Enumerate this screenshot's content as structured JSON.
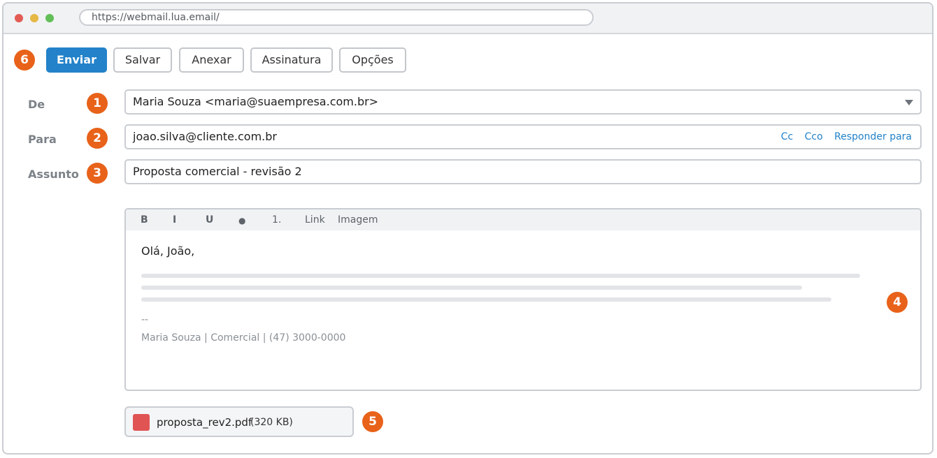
{
  "browser": {
    "url": "https://webmail.lua.email/"
  },
  "toolbar": {
    "badge": "6",
    "send_label": "Enviar",
    "save_label": "Salvar",
    "attach_label": "Anexar",
    "signature_label": "Assinatura",
    "options_label": "Opções"
  },
  "fields": {
    "from": {
      "label": "De",
      "badge": "1",
      "value": "Maria Souza <maria@suaempresa.com.br>"
    },
    "to": {
      "label": "Para",
      "badge": "2",
      "value": "joao.silva@cliente.com.br",
      "cc": "Cc",
      "bcc": "Cco",
      "reply_to": "Responder para"
    },
    "subject": {
      "label": "Assunto",
      "badge": "3",
      "value": "Proposta comercial - revisão 2"
    }
  },
  "editor": {
    "badge": "4",
    "toolbar": {
      "bold": "B",
      "italic": "I",
      "underline": "U",
      "bullet_list": "●",
      "numbered_list": "1.",
      "link": "Link",
      "image": "Imagem"
    },
    "greeting": "Olá, João,",
    "signature_separator": "--",
    "signature": "Maria Souza | Comercial | (47) 3000-0000"
  },
  "attachment": {
    "badge": "5",
    "icon": "pdf-file-icon",
    "filename": "proposta_rev2.pdf",
    "size": "(320 KB)"
  },
  "colors": {
    "accent": "#2382c9",
    "badge": "#e8621a",
    "pdf": "#e05454"
  }
}
